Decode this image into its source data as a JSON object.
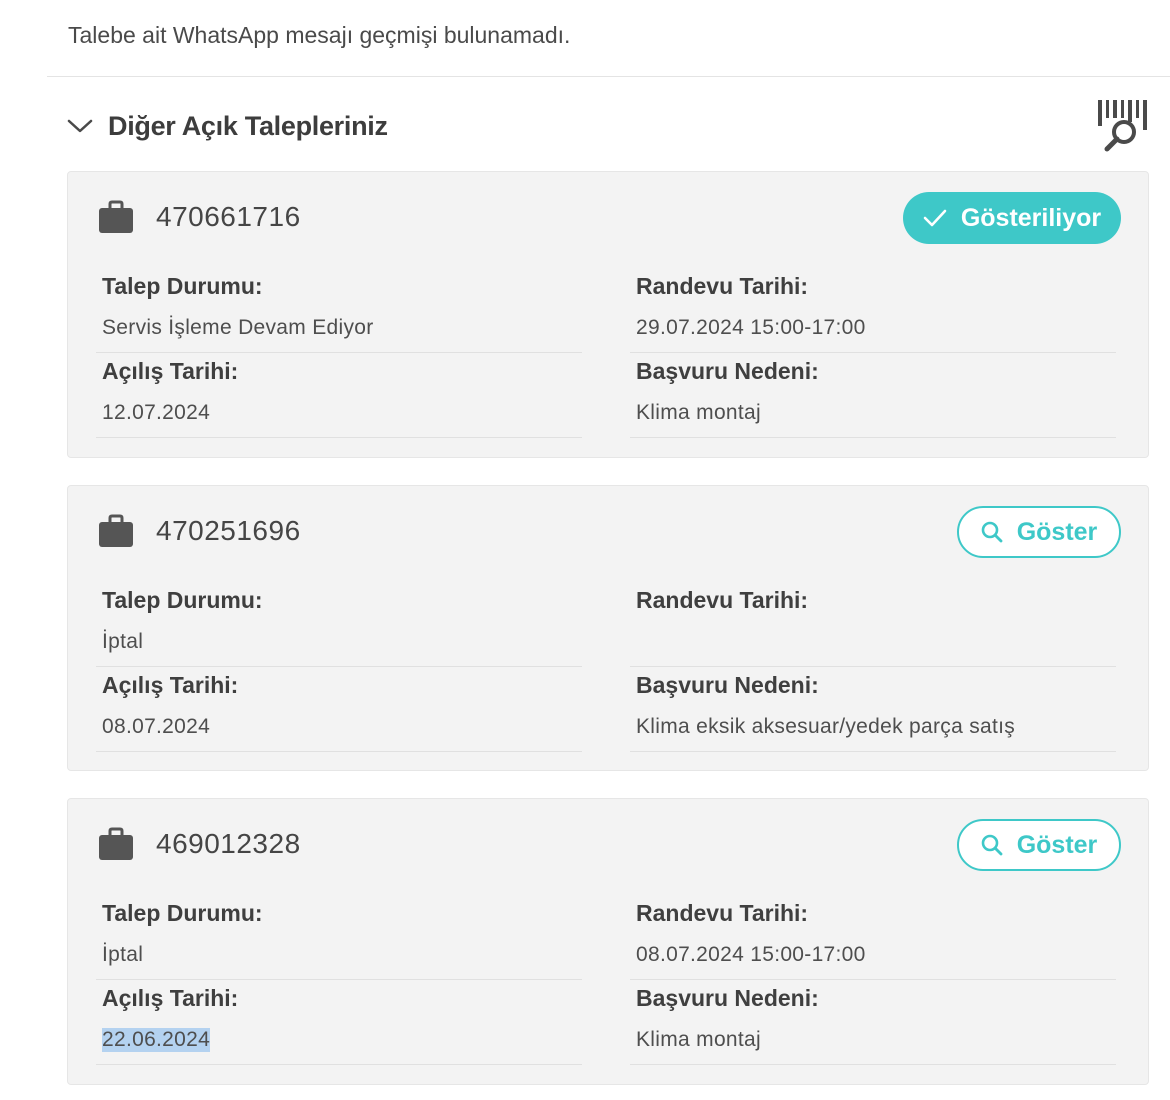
{
  "notice": "Talebe ait WhatsApp mesajı geçmişi bulunamadı.",
  "section": {
    "title": "Diğer Açık Talepleriniz",
    "chevron_icon": "chevron-down-icon",
    "tool_icon": "barcode-search-icon"
  },
  "accent_color": "#3ec8c8",
  "labels": {
    "status": "Talep Durumu:",
    "appointment": "Randevu Tarihi:",
    "opened": "Açılış Tarihi:",
    "reason": "Başvuru Nedeni:"
  },
  "requests": [
    {
      "id": "470661716",
      "button_label": "Gösteriliyor",
      "button_icon": "checkmark-icon",
      "active": true,
      "status": "Servis İşleme Devam Ediyor",
      "appointment": "29.07.2024 15:00-17:00",
      "opened": "12.07.2024",
      "reason": "Klima montaj"
    },
    {
      "id": "470251696",
      "button_label": "Göster",
      "button_icon": "search-icon",
      "active": false,
      "status": "İptal",
      "appointment": "",
      "opened": "08.07.2024",
      "reason": "Klima eksik aksesuar/yedek parça satış"
    },
    {
      "id": "469012328",
      "button_label": "Göster",
      "button_icon": "search-icon",
      "active": false,
      "status": "İptal",
      "appointment": "08.07.2024 15:00-17:00",
      "opened": "22.06.2024",
      "opened_selected": true,
      "reason": "Klima montaj"
    }
  ]
}
